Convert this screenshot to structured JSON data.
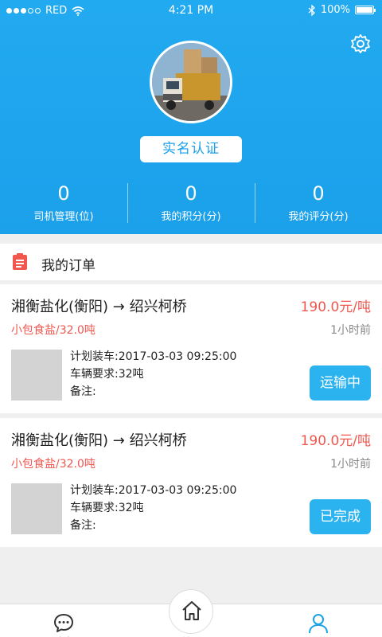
{
  "status_bar": {
    "carrier": "RED",
    "time": "4:21 PM",
    "battery": "100%"
  },
  "profile": {
    "auth_button": "实名认证"
  },
  "stats": [
    {
      "value": "0",
      "label": "司机管理(位)"
    },
    {
      "value": "0",
      "label": "我的积分(分)"
    },
    {
      "value": "0",
      "label": "我的评分(分)"
    }
  ],
  "orders_section": {
    "title": "我的订单"
  },
  "orders": [
    {
      "route": "湘衡盐化(衡阳) → 绍兴柯桥",
      "price": "190.0元/吨",
      "cargo": "小包食盐/32.0吨",
      "time_ago": "1小时前",
      "plan_label": "计划装车:",
      "plan_value": "2017-03-03  09:25:00",
      "vehicle_label": "车辆要求:",
      "vehicle_value": "32吨",
      "note_label": "备注:",
      "status": "运输中"
    },
    {
      "route": "湘衡盐化(衡阳) → 绍兴柯桥",
      "price": "190.0元/吨",
      "cargo": "小包食盐/32.0吨",
      "time_ago": "1小时前",
      "plan_label": "计划装车:",
      "plan_value": "2017-03-03  09:25:00",
      "vehicle_label": "车辆要求:",
      "vehicle_value": "32吨",
      "note_label": "备注:",
      "status": "已完成"
    }
  ],
  "tabbar": {
    "items": [
      {
        "label": "消息",
        "icon": "message-icon"
      },
      {
        "label": "首页",
        "icon": "home-icon"
      },
      {
        "label": "我的",
        "icon": "user-icon"
      }
    ]
  },
  "colors": {
    "primary": "#1ba0ea",
    "price": "#f0574f",
    "status_button": "#2bb3ef"
  }
}
